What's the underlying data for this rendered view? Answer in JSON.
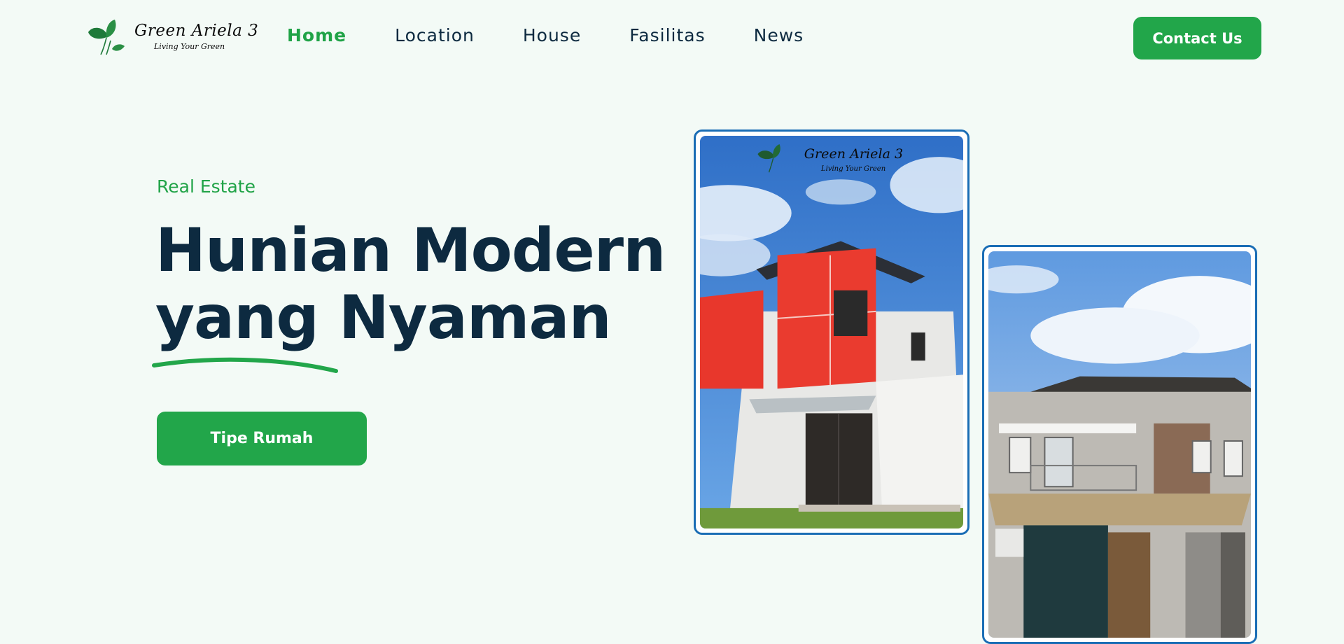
{
  "header": {
    "logo": {
      "name": "Green Ariela 3",
      "tagline": "Living Your Green",
      "icon": "leaf-icon"
    },
    "nav": [
      {
        "label": "Home",
        "active": true
      },
      {
        "label": "Location",
        "active": false
      },
      {
        "label": "House",
        "active": false
      },
      {
        "label": "Fasilitas",
        "active": false
      },
      {
        "label": "News",
        "active": false
      }
    ],
    "contact_label": "Contact Us"
  },
  "hero": {
    "eyebrow": "Real Estate",
    "title_line1": "Hunian Modern",
    "title_line2": "yang Nyaman",
    "cta_label": "Tipe Rumah"
  },
  "images": {
    "house_1": {
      "logo_name": "Green Ariela 3",
      "logo_tagline": "Living Your Green"
    }
  },
  "colors": {
    "accent": "#22a64a",
    "heading": "#0d2a40",
    "background": "#f3faf6",
    "card_border": "#1a6db5"
  }
}
